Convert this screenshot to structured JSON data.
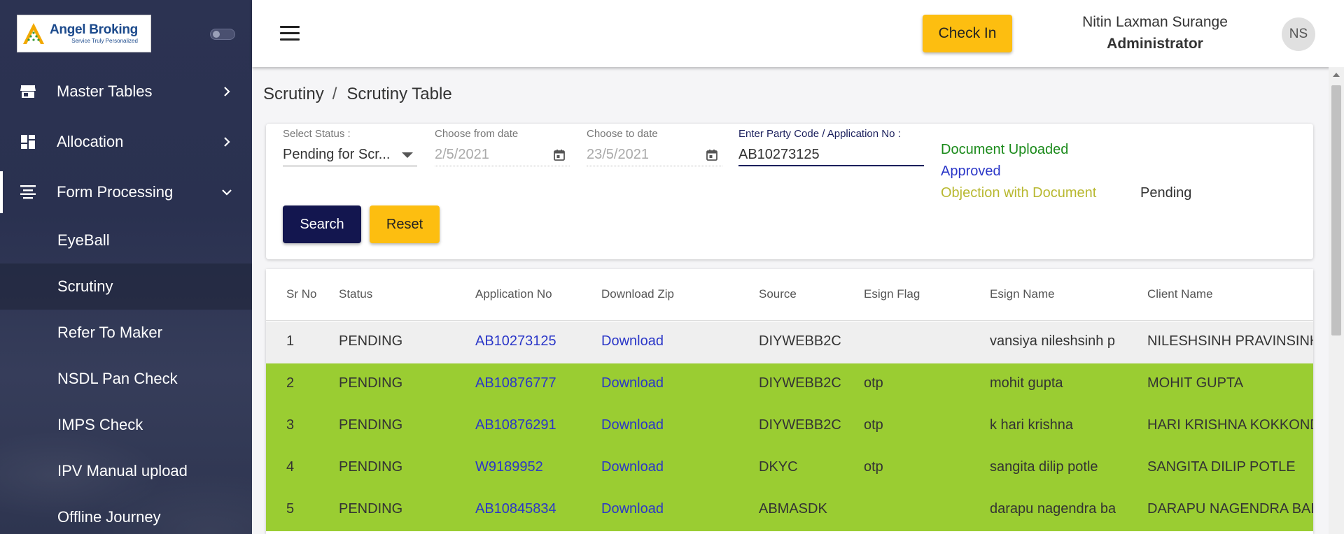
{
  "brand": {
    "name": "Angel Broking",
    "tagline": "Service Truly Personalized"
  },
  "sidebar": {
    "menu": [
      {
        "label": "Master Tables",
        "icon": "store-icon"
      },
      {
        "label": "Allocation",
        "icon": "dashboard-icon"
      },
      {
        "label": "Form Processing",
        "icon": "form-list-icon"
      }
    ],
    "sub_items": [
      {
        "label": "EyeBall"
      },
      {
        "label": "Scrutiny"
      },
      {
        "label": "Refer To Maker"
      },
      {
        "label": "NSDL Pan Check"
      },
      {
        "label": "IMPS Check"
      },
      {
        "label": "IPV Manual upload"
      },
      {
        "label": "Offline Journey"
      }
    ]
  },
  "header": {
    "check_in_label": "Check In",
    "user_name": "Nitin Laxman Surange",
    "user_role": "Administrator",
    "avatar_initials": "NS"
  },
  "breadcrumb": {
    "parent": "Scrutiny",
    "separator": "/",
    "current": "Scrutiny Table"
  },
  "filters": {
    "status_label": "Select Status :",
    "status_value": "Pending for Scr...",
    "from_label": "Choose from date",
    "from_value": "2/5/2021",
    "to_label": "Choose to date",
    "to_value": "23/5/2021",
    "party_label": "Enter Party Code / Application No :",
    "party_value": "AB10273125",
    "search_label": "Search",
    "reset_label": "Reset"
  },
  "legend": {
    "uploaded": "Document Uploaded",
    "approved": "Approved",
    "objection": "Objection with Document",
    "pending": "Pending",
    "colors": {
      "uploaded": "#1a8a1a",
      "approved": "#2b37c8",
      "objection": "#b8b830",
      "pending": "#333333"
    }
  },
  "table": {
    "headers": [
      "Sr No",
      "Status",
      "Application No",
      "Download Zip",
      "Source",
      "Esign Flag",
      "Esign Name",
      "Client Name"
    ],
    "rows": [
      {
        "sr": "1",
        "status": "PENDING",
        "app_no": "AB10273125",
        "download": "Download",
        "source": "DIYWEBB2C",
        "esign_flag": "",
        "esign_name": "vansiya nileshsinh pravinsinh",
        "client_name": "NILESHSINH PRAVINSINH VANSIYA",
        "color": "grey"
      },
      {
        "sr": "2",
        "status": "PENDING",
        "app_no": "AB10876777",
        "download": "Download",
        "source": "DIYWEBB2C",
        "esign_flag": "otp",
        "esign_name": "mohit gupta",
        "client_name": "MOHIT GUPTA",
        "color": "green"
      },
      {
        "sr": "3",
        "status": "PENDING",
        "app_no": "AB10876291",
        "download": "Download",
        "source": "DIYWEBB2C",
        "esign_flag": "otp",
        "esign_name": "k hari krishna",
        "client_name": "HARI KRISHNA KOKKONDA",
        "color": "green"
      },
      {
        "sr": "4",
        "status": "PENDING",
        "app_no": "W9189952",
        "download": "Download",
        "source": "DKYC",
        "esign_flag": "otp",
        "esign_name": "sangita dilip potle",
        "client_name": "SANGITA DILIP POTLE",
        "color": "green"
      },
      {
        "sr": "5",
        "status": "PENDING",
        "app_no": "AB10845834",
        "download": "Download",
        "source": "ABMASDK",
        "esign_flag": "",
        "esign_name": "darapu nagendra babu",
        "client_name": "DARAPU NAGENDRA BABU",
        "color": "green"
      }
    ]
  }
}
